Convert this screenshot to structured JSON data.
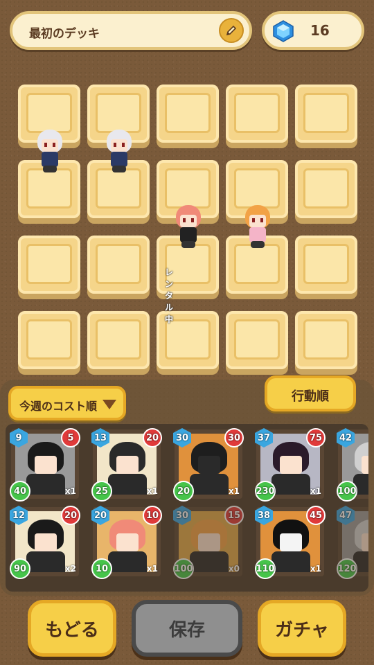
{
  "deck": {
    "name": "最初のデッキ",
    "edit_icon": "pencil-icon"
  },
  "currency": {
    "icon": "diamond-gem-icon",
    "amount": "16"
  },
  "board": {
    "rows": 4,
    "cols": 5,
    "units": [
      {
        "row": 1,
        "col": 0,
        "name": "white-haired-fighter",
        "hair": "#e8e8ee",
        "body": "#2b3a66"
      },
      {
        "row": 1,
        "col": 1,
        "name": "white-haired-fighter",
        "hair": "#e8e8ee",
        "body": "#2b3a66"
      },
      {
        "row": 2,
        "col": 2,
        "name": "pink-haired-girl",
        "hair": "#f08a78",
        "body": "#222222",
        "label": "レンタル中"
      },
      {
        "row": 2,
        "col": 3,
        "name": "orange-haired-girl",
        "hair": "#f2a246",
        "body": "#f4b4c8"
      }
    ]
  },
  "sort_button": {
    "label": "今週のコスト順",
    "icon": "triangle-down-icon"
  },
  "order_button": {
    "label": "行動順"
  },
  "cards": [
    {
      "cost": "9",
      "power": "5",
      "hp": "40",
      "count": "x1",
      "bg": "#9a9a9a",
      "char": "black-haired-boy",
      "dim": false
    },
    {
      "cost": "13",
      "power": "20",
      "hp": "25",
      "count": "x1",
      "bg": "#f2e6c8",
      "char": "black-cat-girl",
      "dim": false
    },
    {
      "cost": "30",
      "power": "30",
      "hp": "20",
      "count": "x1",
      "bg": "#e0913c",
      "char": "black-demon",
      "dim": false
    },
    {
      "cost": "37",
      "power": "75",
      "hp": "230",
      "count": "x1",
      "bg": "#b7b7c4",
      "char": "dark-haired-woman",
      "dim": false
    },
    {
      "cost": "42",
      "power": "",
      "hp": "100",
      "count": "",
      "bg": "#9a9a9a",
      "char": "grey-figure",
      "dim": false
    },
    {
      "cost": "12",
      "power": "20",
      "hp": "90",
      "count": "x2",
      "bg": "#f2e6c8",
      "char": "glasses-boy",
      "dim": false
    },
    {
      "cost": "20",
      "power": "10",
      "hp": "10",
      "count": "x1",
      "bg": "#e8b56a",
      "char": "pink-haired-girl",
      "dim": false
    },
    {
      "cost": "30",
      "power": "15",
      "hp": "100",
      "count": "x0",
      "bg": "#e0a84a",
      "char": "orange-haired-girl",
      "dim": true
    },
    {
      "cost": "38",
      "power": "45",
      "hp": "110",
      "count": "x1",
      "bg": "#e0913c",
      "char": "white-mask-figure",
      "dim": false
    },
    {
      "cost": "47",
      "power": "",
      "hp": "120",
      "count": "",
      "bg": "#9a9a9a",
      "char": "grey-figure",
      "dim": true
    }
  ],
  "buttons": {
    "back": "もどる",
    "save": "保存",
    "gacha": "ガチャ"
  }
}
